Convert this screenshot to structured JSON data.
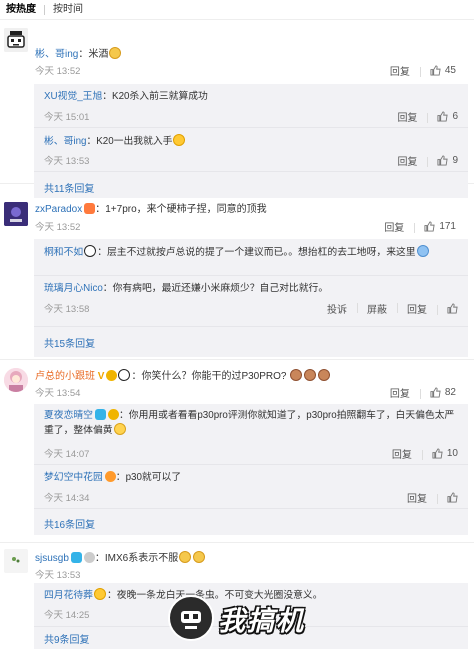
{
  "sort_tabs": {
    "hot": "按热度",
    "time": "按时间"
  },
  "actions": {
    "reply": "回复",
    "report": "投诉",
    "block": "屏蔽"
  },
  "comments": [
    {
      "user": "彬、哥ing",
      "text": "米酒",
      "time": "今天 13:52",
      "likes": "45",
      "replies": [
        {
          "user": "XU视觉_王旭",
          "text": "K20杀入前三就算成功",
          "time": "今天 15:01",
          "likes": "6"
        },
        {
          "user": "彬、哥ing",
          "text": "K20一出我就入手",
          "time": "今天 13:53",
          "likes": "9"
        }
      ],
      "more": "共11条回复"
    },
    {
      "user": "zxParadox",
      "text": "1+7pro，来个硬柿子捏，同意的顶我",
      "time": "今天 13:52",
      "likes": "171",
      "replies": [
        {
          "user": "桐和不如",
          "text": "层主不过就按卢总说的提了一个建议而已。。想抬杠的去工地呀，来这里",
          "time": "",
          "likes": ""
        },
        {
          "user": "琉璃月心Nico",
          "text": "你有病吧，最近还嫌小米麻烦少？自己对比就行。",
          "time": "今天 13:58",
          "likes": ""
        }
      ],
      "more": "共15条回复"
    },
    {
      "user": "卢总的小跟班",
      "text": "你笑什么？你能干的过P30PRO?",
      "time": "今天 13:54",
      "likes": "82",
      "replies": [
        {
          "user": "夏夜恋晴空",
          "text": "你用用或者看看p30pro评测你就知道了，p30pro拍照翻车了，白天偏色太严重了，整体偏黄",
          "time": "今天 14:07",
          "likes": "10"
        },
        {
          "user": "梦幻空中花园",
          "text": "p30就可以了",
          "time": "今天 14:34",
          "likes": ""
        }
      ],
      "more": "共16条回复"
    },
    {
      "user": "sjsusgb",
      "text": "IMX6系表示不服",
      "time": "今天 13:53",
      "likes": "",
      "replies": [
        {
          "user": "四月花待葬",
          "text": "夜晚一条龙白天一条虫。不可变大光圈没意义。",
          "time": "今天 14:25",
          "likes": ""
        }
      ],
      "more": "共9条回复"
    }
  ],
  "watermark": "我搞机",
  "colors": {
    "link": "#2e72b8",
    "reply_bg": "#f2f2f5",
    "divider": "#eeeeee"
  }
}
